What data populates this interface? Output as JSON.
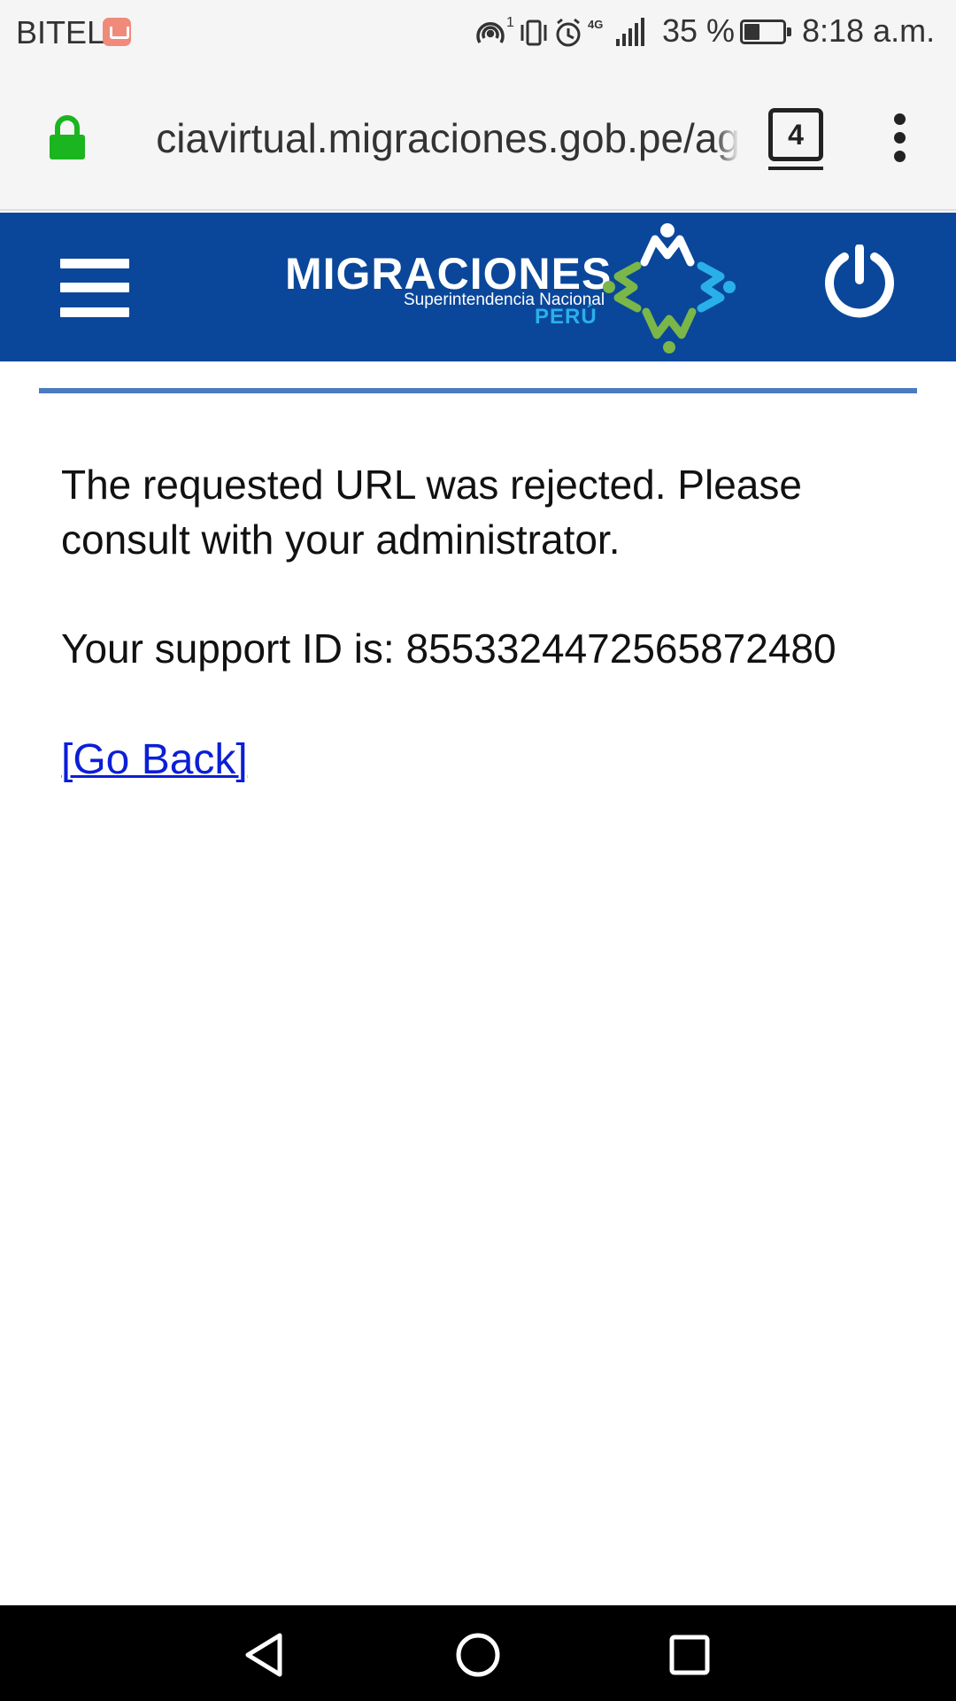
{
  "status_bar": {
    "carrier": "BITEL",
    "network_label": "4G",
    "hotspot_badge": "1",
    "battery_percent": "35 %",
    "time": "8:18 a.m."
  },
  "browser": {
    "url": "ciavirtual.migraciones.gob.pe/ag",
    "tab_count": "4"
  },
  "site_header": {
    "brand": "MIGRACIONES",
    "subtitle": "Superintendencia Nacional",
    "country": "PERÚ",
    "colors": {
      "header_bg": "#0a479a",
      "accent_blue": "#2ab0e8",
      "accent_green": "#7ab648"
    }
  },
  "content": {
    "message": "The requested URL was rejected. Please consult with your administrator.",
    "support_id_label": "Your support ID is: 8553324472565872480",
    "go_back_label": "[Go Back]"
  },
  "icons": {
    "lock": "lock-icon",
    "tabs": "tabs-icon",
    "menu": "more-vert-icon",
    "hamburger": "hamburger-menu-icon",
    "power": "power-icon",
    "back": "back-triangle-icon",
    "home": "home-circle-icon",
    "recents": "recents-square-icon"
  }
}
